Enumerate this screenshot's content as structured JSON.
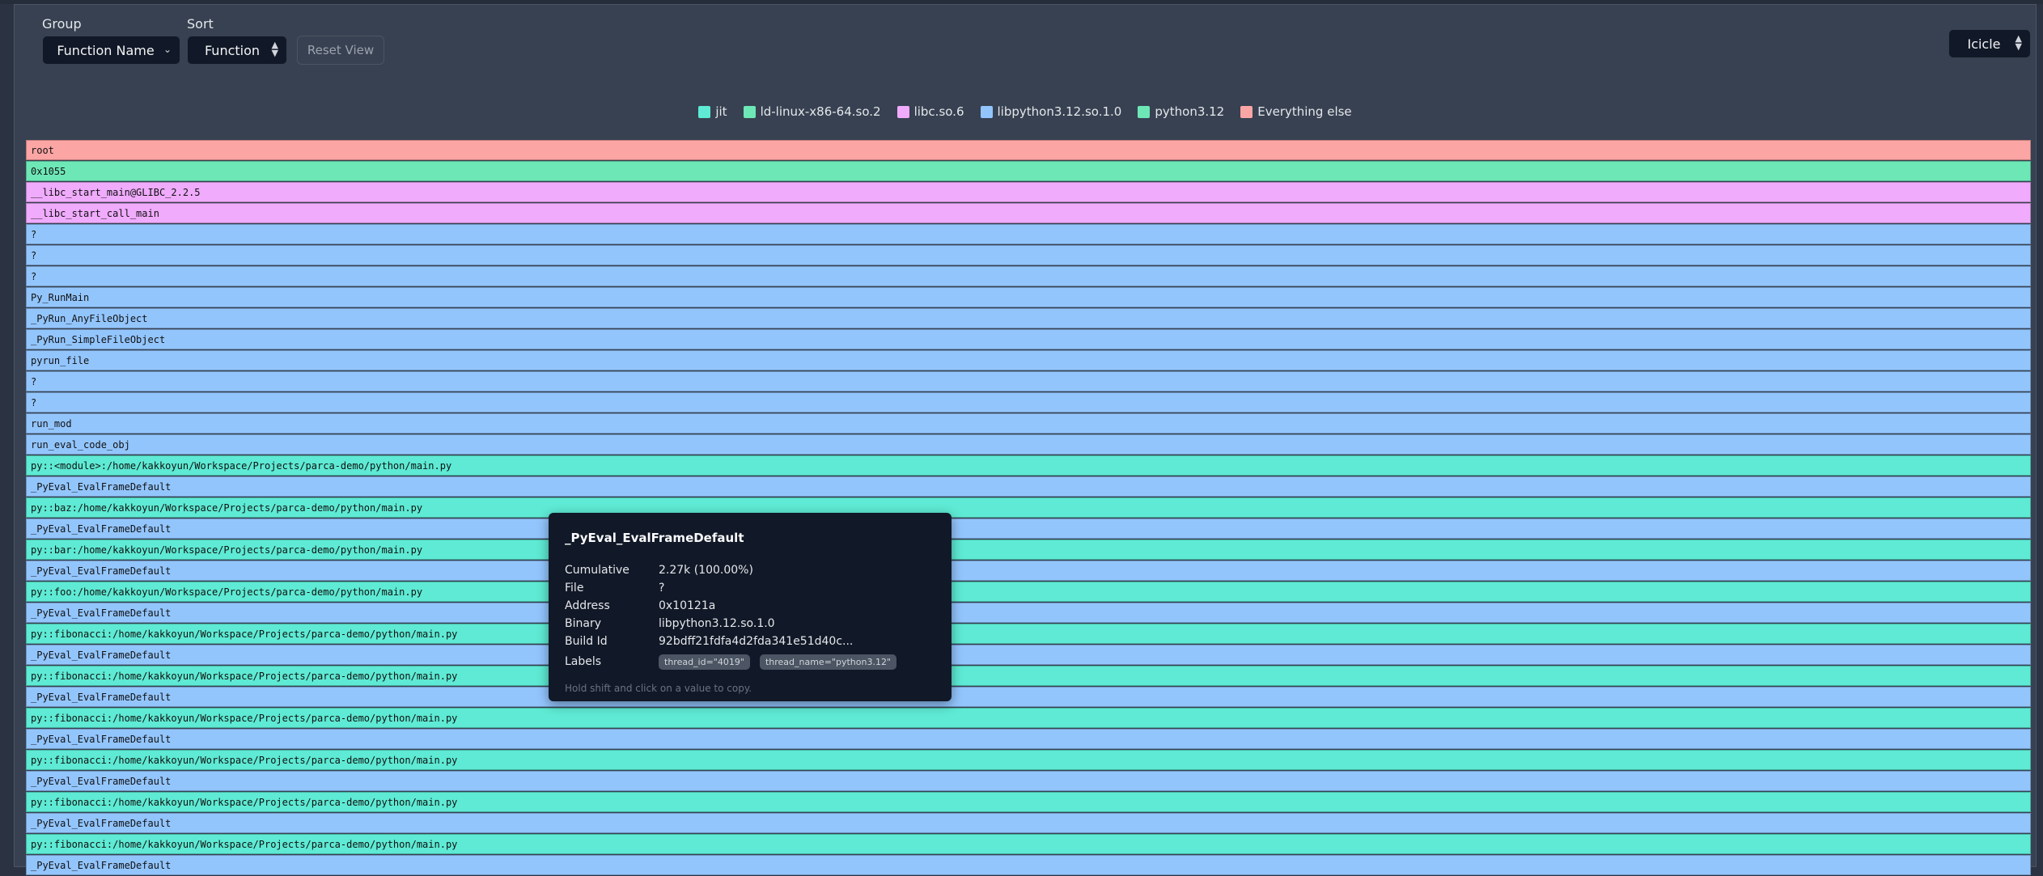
{
  "toolbar": {
    "group_label": "Group",
    "group_value": "Function Name",
    "sort_label": "Sort",
    "sort_value": "Function",
    "reset_label": "Reset View",
    "view_value": "Icicle"
  },
  "legend": [
    {
      "label": "jit",
      "color": "#5eead4"
    },
    {
      "label": "ld-linux-x86-64.so.2",
      "color": "#6ee7b7"
    },
    {
      "label": "libc.so.6",
      "color": "#f0abfc"
    },
    {
      "label": "libpython3.12.so.1.0",
      "color": "#93c5fd"
    },
    {
      "label": "python3.12",
      "color": "#6ee7b7"
    },
    {
      "label": "Everything else",
      "color": "#fca5a5"
    }
  ],
  "frames": [
    {
      "label": "root",
      "color": "#fca5a5"
    },
    {
      "label": "0x1055",
      "color": "#6ee7b7"
    },
    {
      "label": "__libc_start_main@GLIBC_2.2.5",
      "color": "#f0abfc"
    },
    {
      "label": "__libc_start_call_main",
      "color": "#f0abfc"
    },
    {
      "label": "?",
      "color": "#93c5fd"
    },
    {
      "label": "?",
      "color": "#93c5fd"
    },
    {
      "label": "?",
      "color": "#93c5fd"
    },
    {
      "label": "Py_RunMain",
      "color": "#93c5fd"
    },
    {
      "label": "_PyRun_AnyFileObject",
      "color": "#93c5fd"
    },
    {
      "label": "_PyRun_SimpleFileObject",
      "color": "#93c5fd"
    },
    {
      "label": "pyrun_file",
      "color": "#93c5fd"
    },
    {
      "label": "?",
      "color": "#93c5fd"
    },
    {
      "label": "?",
      "color": "#93c5fd"
    },
    {
      "label": "run_mod",
      "color": "#93c5fd"
    },
    {
      "label": "run_eval_code_obj",
      "color": "#93c5fd"
    },
    {
      "label": "py::<module>:/home/kakkoyun/Workspace/Projects/parca-demo/python/main.py",
      "color": "#5eead4"
    },
    {
      "label": "_PyEval_EvalFrameDefault",
      "color": "#93c5fd"
    },
    {
      "label": "py::baz:/home/kakkoyun/Workspace/Projects/parca-demo/python/main.py",
      "color": "#5eead4"
    },
    {
      "label": "_PyEval_EvalFrameDefault",
      "color": "#93c5fd"
    },
    {
      "label": "py::bar:/home/kakkoyun/Workspace/Projects/parca-demo/python/main.py",
      "color": "#5eead4"
    },
    {
      "label": "_PyEval_EvalFrameDefault",
      "color": "#93c5fd"
    },
    {
      "label": "py::foo:/home/kakkoyun/Workspace/Projects/parca-demo/python/main.py",
      "color": "#5eead4"
    },
    {
      "label": "_PyEval_EvalFrameDefault",
      "color": "#93c5fd"
    },
    {
      "label": "py::fibonacci:/home/kakkoyun/Workspace/Projects/parca-demo/python/main.py",
      "color": "#5eead4"
    },
    {
      "label": "_PyEval_EvalFrameDefault",
      "color": "#93c5fd"
    },
    {
      "label": "py::fibonacci:/home/kakkoyun/Workspace/Projects/parca-demo/python/main.py",
      "color": "#5eead4"
    },
    {
      "label": "_PyEval_EvalFrameDefault",
      "color": "#93c5fd"
    },
    {
      "label": "py::fibonacci:/home/kakkoyun/Workspace/Projects/parca-demo/python/main.py",
      "color": "#5eead4"
    },
    {
      "label": "_PyEval_EvalFrameDefault",
      "color": "#93c5fd"
    },
    {
      "label": "py::fibonacci:/home/kakkoyun/Workspace/Projects/parca-demo/python/main.py",
      "color": "#5eead4"
    },
    {
      "label": "_PyEval_EvalFrameDefault",
      "color": "#93c5fd"
    },
    {
      "label": "py::fibonacci:/home/kakkoyun/Workspace/Projects/parca-demo/python/main.py",
      "color": "#5eead4"
    },
    {
      "label": "_PyEval_EvalFrameDefault",
      "color": "#93c5fd"
    },
    {
      "label": "py::fibonacci:/home/kakkoyun/Workspace/Projects/parca-demo/python/main.py",
      "color": "#5eead4"
    },
    {
      "label": "_PyEval_EvalFrameDefault",
      "color": "#93c5fd"
    }
  ],
  "tooltip": {
    "title": "_PyEval_EvalFrameDefault",
    "rows": [
      {
        "key": "Cumulative",
        "value": "2.27k (100.00%)"
      },
      {
        "key": "File",
        "value": "?"
      },
      {
        "key": "Address",
        "value": "0x10121a"
      },
      {
        "key": "Binary",
        "value": "libpython3.12.so.1.0"
      },
      {
        "key": "Build Id",
        "value": "92bdff21fdfa4d2fda341e51d40c..."
      }
    ],
    "labels_key": "Labels",
    "labels": [
      "thread_id=\"4019\"",
      "thread_name=\"python3.12\""
    ],
    "hint": "Hold shift and click on a value to copy."
  }
}
